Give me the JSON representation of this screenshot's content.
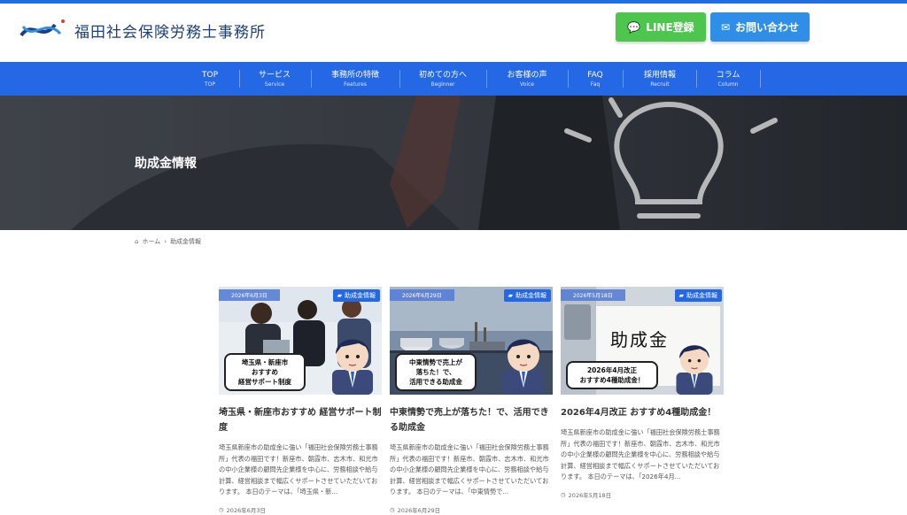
{
  "site": {
    "name": "福田社会保険労務士事務所"
  },
  "header": {
    "line_button": "LINE登録",
    "contact_button": "お問い合わせ"
  },
  "nav": {
    "items": [
      {
        "jp": "TOP",
        "en": "TOP"
      },
      {
        "jp": "サービス",
        "en": "Service"
      },
      {
        "jp": "事務所の特徴",
        "en": "Features"
      },
      {
        "jp": "初めての方へ",
        "en": "Beginner"
      },
      {
        "jp": "お客様の声",
        "en": "Voice"
      },
      {
        "jp": "FAQ",
        "en": "Faq"
      },
      {
        "jp": "採用情報",
        "en": "Recruit"
      },
      {
        "jp": "コラム",
        "en": "Column"
      }
    ]
  },
  "hero": {
    "title": "助成金情報"
  },
  "breadcrumb": {
    "home": "ホーム",
    "current": "助成金情報"
  },
  "cards": [
    {
      "date": "2026年6月3日",
      "category": "助成金情報",
      "bubble": [
        "埼玉県・新座市",
        "おすすめ",
        "経営サポート制度"
      ],
      "title": "埼玉県・新座市おすすめ 経営サポート制度",
      "excerpt": "埼玉県新座市の助成金に強い「福田社会保険労務士事務所」代表の福田です！新座市、朝霞市、志木市、和光市の中小企業様の顧問先企業様を中心に、労務相談や給与計算、経営相談まで幅広くサポートさせていただいております。 本日のテーマは、「埼玉県・新...",
      "footer_date": "2026年6月3日"
    },
    {
      "date": "2026年6月29日",
      "category": "助成金情報",
      "bubble": [
        "中東情勢で売上が",
        "落ちた！で、",
        "活用できる助成金"
      ],
      "title": "中東情勢で売上が落ちた！で、活用できる助成金",
      "excerpt": "埼玉県新座市の助成金に強い「福田社会保険労務士事務所」代表の福田です！新座市、朝霞市、志木市、和光市の中小企業様の顧問先企業様を中心に、労務相談や給与計算、経営相談まで幅広くサポートさせていただいております。 本日のテーマは、「中東情勢で...",
      "footer_date": "2026年6月29日"
    },
    {
      "date": "2026年5月18日",
      "category": "助成金情報",
      "sign_text": "助成金",
      "bubble": [
        "2026年4月改正",
        "おすすめ4種助成金！"
      ],
      "title": "2026年4月改正 おすすめ4種助成金！",
      "excerpt": "埼玉県新座市の助成金に強い「福田社会保険労務士事務所」代表の福田です！新座市、朝霞市、志木市、和光市の中小企業様の顧問先企業様を中心に、労務相談や給与計算、経営相談まで幅広くサポートさせていただいております。 本日のテーマは、「2026年4月...",
      "footer_date": "2026年5月18日"
    }
  ],
  "colors": {
    "primary": "#2568e6",
    "line_green": "#4cc64c",
    "contact_blue": "#2f8fe8",
    "logo_navy": "#1d3f7a"
  }
}
